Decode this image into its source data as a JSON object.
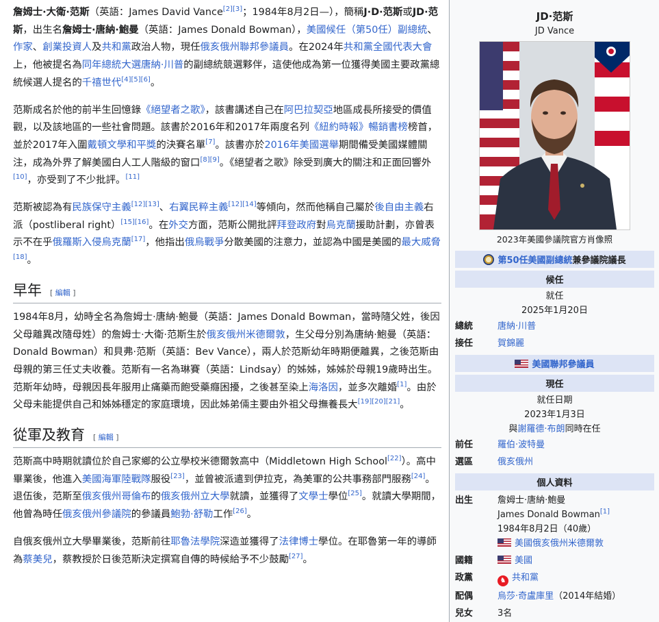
{
  "lead": {
    "p1": {
      "a": "詹姆士·大衛·范斯",
      "b": "（英語：James David Vance",
      "r1": "[2]",
      "r2": "[3]",
      "c": "；1984年8月2日—），簡稱",
      "d": "J·D·范斯",
      "e": "或",
      "f": "JD·范斯",
      "g": "，出生名",
      "h": "詹姆士·唐納·鮑曼",
      "i": "（英語：James Donald Bowman），",
      "l1": "美國候任（第50任）副總統",
      "j": "、",
      "l2": "作家",
      "k": "、",
      "l3": "創業投資人",
      "m": "及",
      "l4": "共和黨",
      "n": "政治人物，現任",
      "l5": "俄亥俄州聯邦參議員",
      "o": "。在2024年",
      "l6": "共和黨全國代表大會",
      "p": "上，他被提名為",
      "l7": "同年總統大選唐納·川普",
      "q": "的副總統競選夥伴，這使他成為第一位獲得美國主要政黨總統候選人提名的",
      "l8": "千禧世代",
      "r3": "[4]",
      "r4": "[5]",
      "r5": "[6]",
      "s": "。"
    },
    "p2": {
      "a": "范斯成名於他的前半生回憶錄",
      "l1": "《絕望者之歌》",
      "b": "，該書講述自己在",
      "l2": "阿巴拉契亞",
      "c": "地區成長所接受的價值觀，以及該地區的一些社會問題。該書於2016年和2017年兩度名列",
      "l3": "《紐約時報》暢銷書榜",
      "d": "榜首，並於2017年入圍",
      "l4": "戴頓文學和平獎",
      "e": "的決賽名單",
      "r1": "[7]",
      "f": "。該書亦於",
      "l5": "2016年美國選舉",
      "g": "期間備受美國媒體關注，成為外界了解美國白人工人階級的窗口",
      "r2": "[8]",
      "r3": "[9]",
      "h": "。《絕望者之歌》除受到廣大的關注和正面回響外",
      "r4": "[10]",
      "i": "，亦受到了不少批評。",
      "r5": "[11]"
    },
    "p3": {
      "a": "范斯被認為有",
      "l1": "民族保守主義",
      "r1": "[12]",
      "r2": "[13]",
      "b": "、",
      "l2": "右翼民粹主義",
      "r3": "[12]",
      "r4": "[14]",
      "c": "等傾向，然而他稱自己屬於",
      "l3": "後自由主義",
      "d": "右派（postliberal right）",
      "r5": "[15]",
      "r6": "[16]",
      "e": "。在",
      "l4": "外交",
      "f": "方面，范斯公開批評",
      "l5": "拜登政府",
      "g": "對",
      "l6": "烏克蘭",
      "h": "援助計劃，亦曾表示不在乎",
      "l7": "俄羅斯入侵烏克蘭",
      "r7": "[17]",
      "i": "，他指出",
      "l8": "俄烏戰爭",
      "j": "分散美國的注意力，並認為中國是美國的",
      "l9": "最大威脅",
      "r8": "[18]",
      "k": "。"
    }
  },
  "early": {
    "heading": "早年",
    "edit": "編輯",
    "p1": {
      "a": "1984年8月，幼時全名為詹姆士·唐納·鮑曼（英語：James Donald Bowman，當時隨父姓，後因父母離異改隨母姓）的詹姆士·大衛·范斯生於",
      "l1": "俄亥俄州米德爾敦",
      "b": "，生父母分別為唐納·鮑曼（英語：Donald Bowman）和貝弗·范斯（英語：Bev Vance），兩人於范斯幼年時期便離異，之後范斯由母親的第三任丈夫收養。范斯有一名為琳賽（英語：Lindsay）的姊姊，姊姊於母親19歲時出生。范斯年幼時，母親因長年服用止痛藥而飽受藥癮困擾，之後甚至染上",
      "l2": "海洛因",
      "c": "，並多次離婚",
      "r1": "[1]",
      "d": "。由於父母未能提供自己和姊姊穩定的家庭環境，因此姊弟倆主要由外祖父母撫養長大",
      "r2": "[19]",
      "r3": "[20]",
      "r4": "[21]",
      "e": "。"
    }
  },
  "military": {
    "heading": "從軍及教育",
    "edit": "編輯",
    "p1": {
      "a": "范斯高中時期就讀位於自己家鄉的公立學校米德爾敦高中（Middletown High School",
      "r1": "[22]",
      "b": "）。高中畢業後，他進入",
      "l1": "美國海軍陸戰隊",
      "c": "服役",
      "r2": "[23]",
      "d": "，並曾被派遣到伊拉克，為美軍的公共事務部門服務",
      "r3": "[24]",
      "e": "。退伍後，范斯至",
      "l2": "俄亥俄州哥倫布",
      "f": "的",
      "l3": "俄亥俄州立大學",
      "g": "就讀，並獲得了",
      "l4": "文學士",
      "h": "學位",
      "r4": "[25]",
      "i": "。就讀大學期間，他曾為時任",
      "l5": "俄亥俄州參議院",
      "j": "的參議員",
      "l6": "鮑勃·舒勒",
      "k": "工作",
      "r5": "[26]",
      "m": "。"
    },
    "p2": {
      "a": "自俄亥俄州立大學畢業後，范斯前往",
      "l1": "耶魯法學院",
      "b": "深造並獲得了",
      "l2": "法律博士",
      "c": "學位。在耶魯第一年的導師為",
      "l3": "蔡美兒",
      "d": "，蔡教授於日後范斯決定撰寫自傳的時候給予不少鼓勵",
      "r1": "[27]",
      "e": "。"
    }
  },
  "infobox": {
    "title": "JD·范斯",
    "subtitle": "JD Vance",
    "caption": "2023年美國參議院官方肖像照",
    "office1": "第50任美國副總統兼參議院議長",
    "office1_link": "第50任美國副總統",
    "office1_rest": "兼參議院議長",
    "status1": "候任",
    "start1_label": "就任",
    "start1_date": "2025年1月20日",
    "rows1": [
      {
        "label": "總統",
        "value": "唐納·川普"
      },
      {
        "label": "接任",
        "value": "賀錦麗"
      }
    ],
    "office2": "美國聯邦參議員",
    "status2": "現任",
    "start2_label": "就任日期",
    "start2_date": "2023年1月3日",
    "with_pre": "與",
    "with_link": "謝羅德·布朗",
    "with_post": "同時在任",
    "rows2": [
      {
        "label": "前任",
        "value": "羅伯·波特曼"
      },
      {
        "label": "選區",
        "value": "俄亥俄州"
      }
    ],
    "personal": "個人資料",
    "born_label": "出生",
    "born_name": "詹姆士·唐納·鮑曼",
    "born_en": "James Donald Bowman",
    "born_ref": "[1]",
    "born_date": "1984年8月2日（40歲）",
    "born_place": "美國俄亥俄州米德爾敦",
    "nationality_label": "國籍",
    "nationality": "美國",
    "party_label": "政黨",
    "party": "共和黨",
    "spouse_label": "配偶",
    "spouse_link": "烏莎·奇盧庫里",
    "spouse_rest": "（2014年結婚）",
    "children_label": "兒女",
    "children": "3名"
  },
  "colors": {
    "link": "#3366cc",
    "header_bg": "#dde4f5",
    "infobox_bg": "#f8f9fa"
  }
}
